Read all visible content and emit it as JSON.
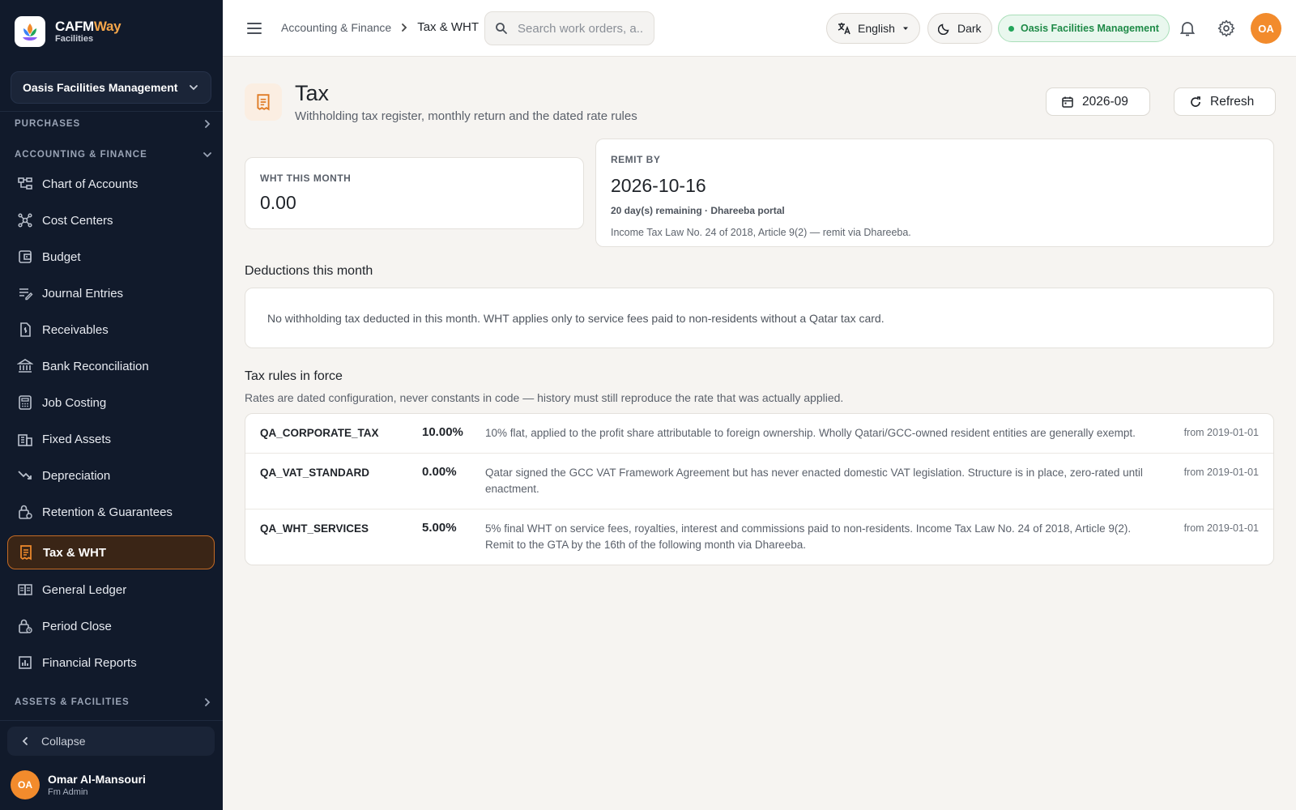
{
  "brand": {
    "name_a": "CAFM",
    "name_b": "Way",
    "sub": "Facilities"
  },
  "sidebar": {
    "org": "Oasis Facilities Management",
    "sections": {
      "purchases": "PURCHASES",
      "accounting": "ACCOUNTING & FINANCE",
      "assets": "ASSETS & FACILITIES"
    },
    "items": [
      {
        "label": "Chart of Accounts",
        "icon": "chart-of-accounts-icon"
      },
      {
        "label": "Cost Centers",
        "icon": "cost-centers-icon"
      },
      {
        "label": "Budget",
        "icon": "budget-icon"
      },
      {
        "label": "Journal Entries",
        "icon": "journal-icon"
      },
      {
        "label": "Receivables",
        "icon": "receivables-icon"
      },
      {
        "label": "Bank Reconciliation",
        "icon": "bank-icon"
      },
      {
        "label": "Job Costing",
        "icon": "job-costing-icon"
      },
      {
        "label": "Fixed Assets",
        "icon": "fixed-assets-icon"
      },
      {
        "label": "Depreciation",
        "icon": "depreciation-icon"
      },
      {
        "label": "Retention & Guarantees",
        "icon": "retention-icon"
      },
      {
        "label": "Tax & WHT",
        "icon": "tax-icon",
        "active": true
      },
      {
        "label": "General Ledger",
        "icon": "ledger-icon"
      },
      {
        "label": "Period Close",
        "icon": "period-close-icon"
      },
      {
        "label": "Financial Reports",
        "icon": "reports-icon"
      }
    ],
    "collapse": "Collapse",
    "user": {
      "initials": "OA",
      "name": "Omar Al-Mansouri",
      "role": "Fm Admin"
    }
  },
  "topbar": {
    "breadcrumb": {
      "parent": "Accounting & Finance",
      "current": "Tax & WHT"
    },
    "search_placeholder": "Search work orders, a...",
    "language": "English",
    "theme": "Dark",
    "org": "Oasis Facilities Management",
    "avatar": "OA"
  },
  "page": {
    "title": "Tax",
    "subtitle": "Withholding tax register, monthly return and the dated rate rules",
    "period": "2026-09",
    "refresh": "Refresh"
  },
  "kpis": {
    "wht_label": "WHT THIS MONTH",
    "wht_value": "0.00",
    "remit_label": "REMIT BY",
    "remit_date": "2026-10-16",
    "remit_meta": "20 day(s) remaining · Dhareeba portal",
    "remit_note": "Income Tax Law No. 24 of 2018, Article 9(2) — remit via Dhareeba."
  },
  "deductions": {
    "title": "Deductions this month",
    "empty": "No withholding tax deducted in this month. WHT applies only to service fees paid to non-residents without a Qatar tax card."
  },
  "rules": {
    "title": "Tax rules in force",
    "desc": "Rates are dated configuration, never constants in code — history must still reproduce the rate that was actually applied.",
    "rows": [
      {
        "code": "QA_CORPORATE_TAX",
        "rate": "10.00%",
        "desc": "10% flat, applied to the profit share attributable to foreign ownership. Wholly Qatari/GCC-owned resident entities are generally exempt.",
        "from": "from 2019-01-01"
      },
      {
        "code": "QA_VAT_STANDARD",
        "rate": "0.00%",
        "desc": "Qatar signed the GCC VAT Framework Agreement but has never enacted domestic VAT legislation. Structure is in place, zero-rated until enactment.",
        "from": "from 2019-01-01"
      },
      {
        "code": "QA_WHT_SERVICES",
        "rate": "5.00%",
        "desc": "5% final WHT on service fees, royalties, interest and commissions paid to non-residents. Income Tax Law No. 24 of 2018, Article 9(2). Remit to the GTA by the 16th of the following month via Dhareeba.",
        "from": "from 2019-01-01"
      }
    ]
  },
  "colors": {
    "accent": "#f28b2c",
    "sidebar_bg": "#111a2b",
    "active_border": "#c46b25",
    "success": "#1e8a47"
  }
}
